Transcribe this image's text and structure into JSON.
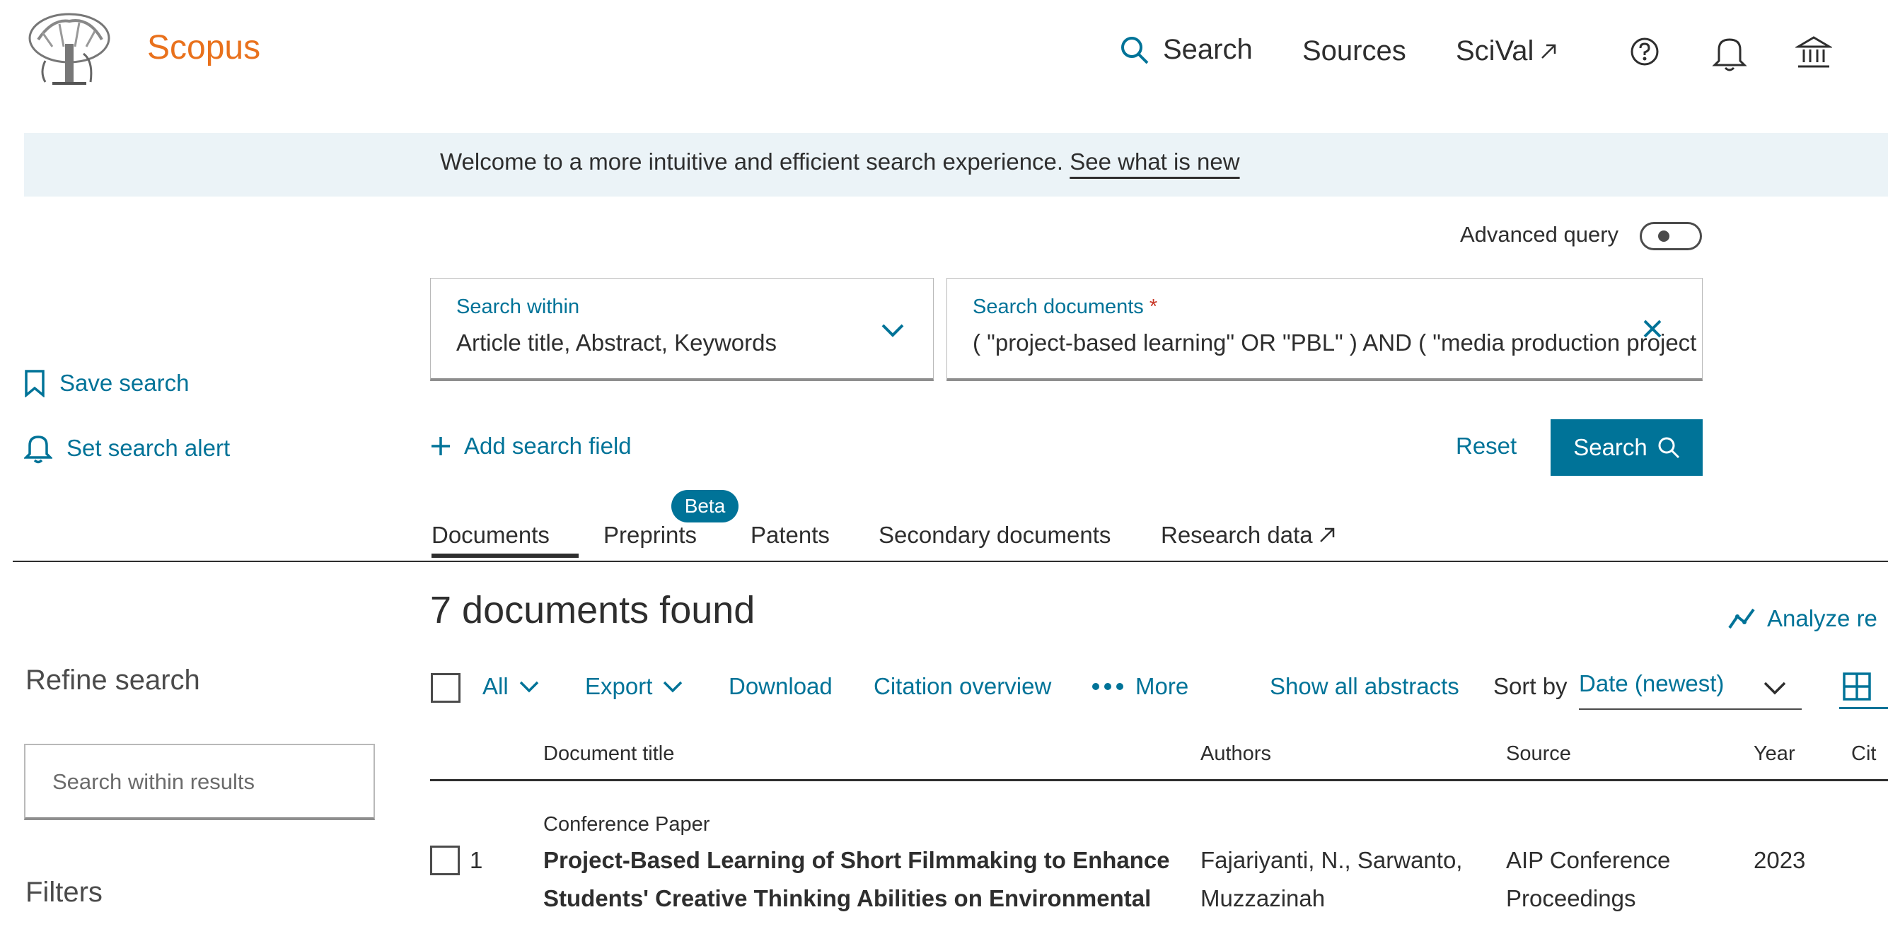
{
  "header": {
    "brand": "Scopus",
    "nav": {
      "search": "Search",
      "sources": "Sources",
      "scival": "SciVal"
    },
    "icons": [
      "search-icon",
      "external-link-icon",
      "help-icon",
      "bell-icon",
      "institution-icon"
    ]
  },
  "banner": {
    "text": "Welcome to a more intuitive and efficient search experience.",
    "link": "See what is new"
  },
  "advanced_query": {
    "label": "Advanced query",
    "enabled": false
  },
  "search_within": {
    "label": "Search within",
    "value": "Article title, Abstract, Keywords"
  },
  "search_documents": {
    "label": "Search documents",
    "required_mark": "*",
    "value": "( \"project-based learning\" OR \"PBL\" ) AND ( \"media production project"
  },
  "sidebar_actions": {
    "save_search": "Save search",
    "set_alert": "Set search alert"
  },
  "actions": {
    "add_field": "Add search field",
    "reset": "Reset",
    "search": "Search"
  },
  "tabs": [
    {
      "label": "Documents",
      "active": true
    },
    {
      "label": "Preprints",
      "badge": "Beta"
    },
    {
      "label": "Patents"
    },
    {
      "label": "Secondary documents"
    },
    {
      "label": "Research data"
    }
  ],
  "results": {
    "count_text": "7 documents found",
    "analyze": "Analyze re"
  },
  "refine": {
    "title": "Refine search",
    "within_placeholder": "Search within results",
    "filters": "Filters"
  },
  "toolbar": {
    "all": "All",
    "export": "Export",
    "download": "Download",
    "citation_overview": "Citation overview",
    "more": "More",
    "show_abstracts": "Show all abstracts",
    "sort_by": "Sort by",
    "sort_value": "Date (newest)"
  },
  "table": {
    "columns": [
      "Document title",
      "Authors",
      "Source",
      "Year",
      "Cit"
    ],
    "rows": [
      {
        "index": "1",
        "type": "Conference Paper",
        "title_lines": [
          "Project-Based Learning of Short Filmmaking to Enhance",
          "Students' Creative Thinking Abilities on Environmental"
        ],
        "authors_lines": [
          "Fajariyanti, N., Sarwanto,",
          "Muzzazinah"
        ],
        "source_lines": [
          "AIP Conference",
          "Proceedings"
        ],
        "year": "2023"
      }
    ]
  },
  "colors": {
    "brand": "#e9711c",
    "accent": "#007398",
    "banner_bg": "#ebf3f7",
    "required": "#c83727"
  }
}
